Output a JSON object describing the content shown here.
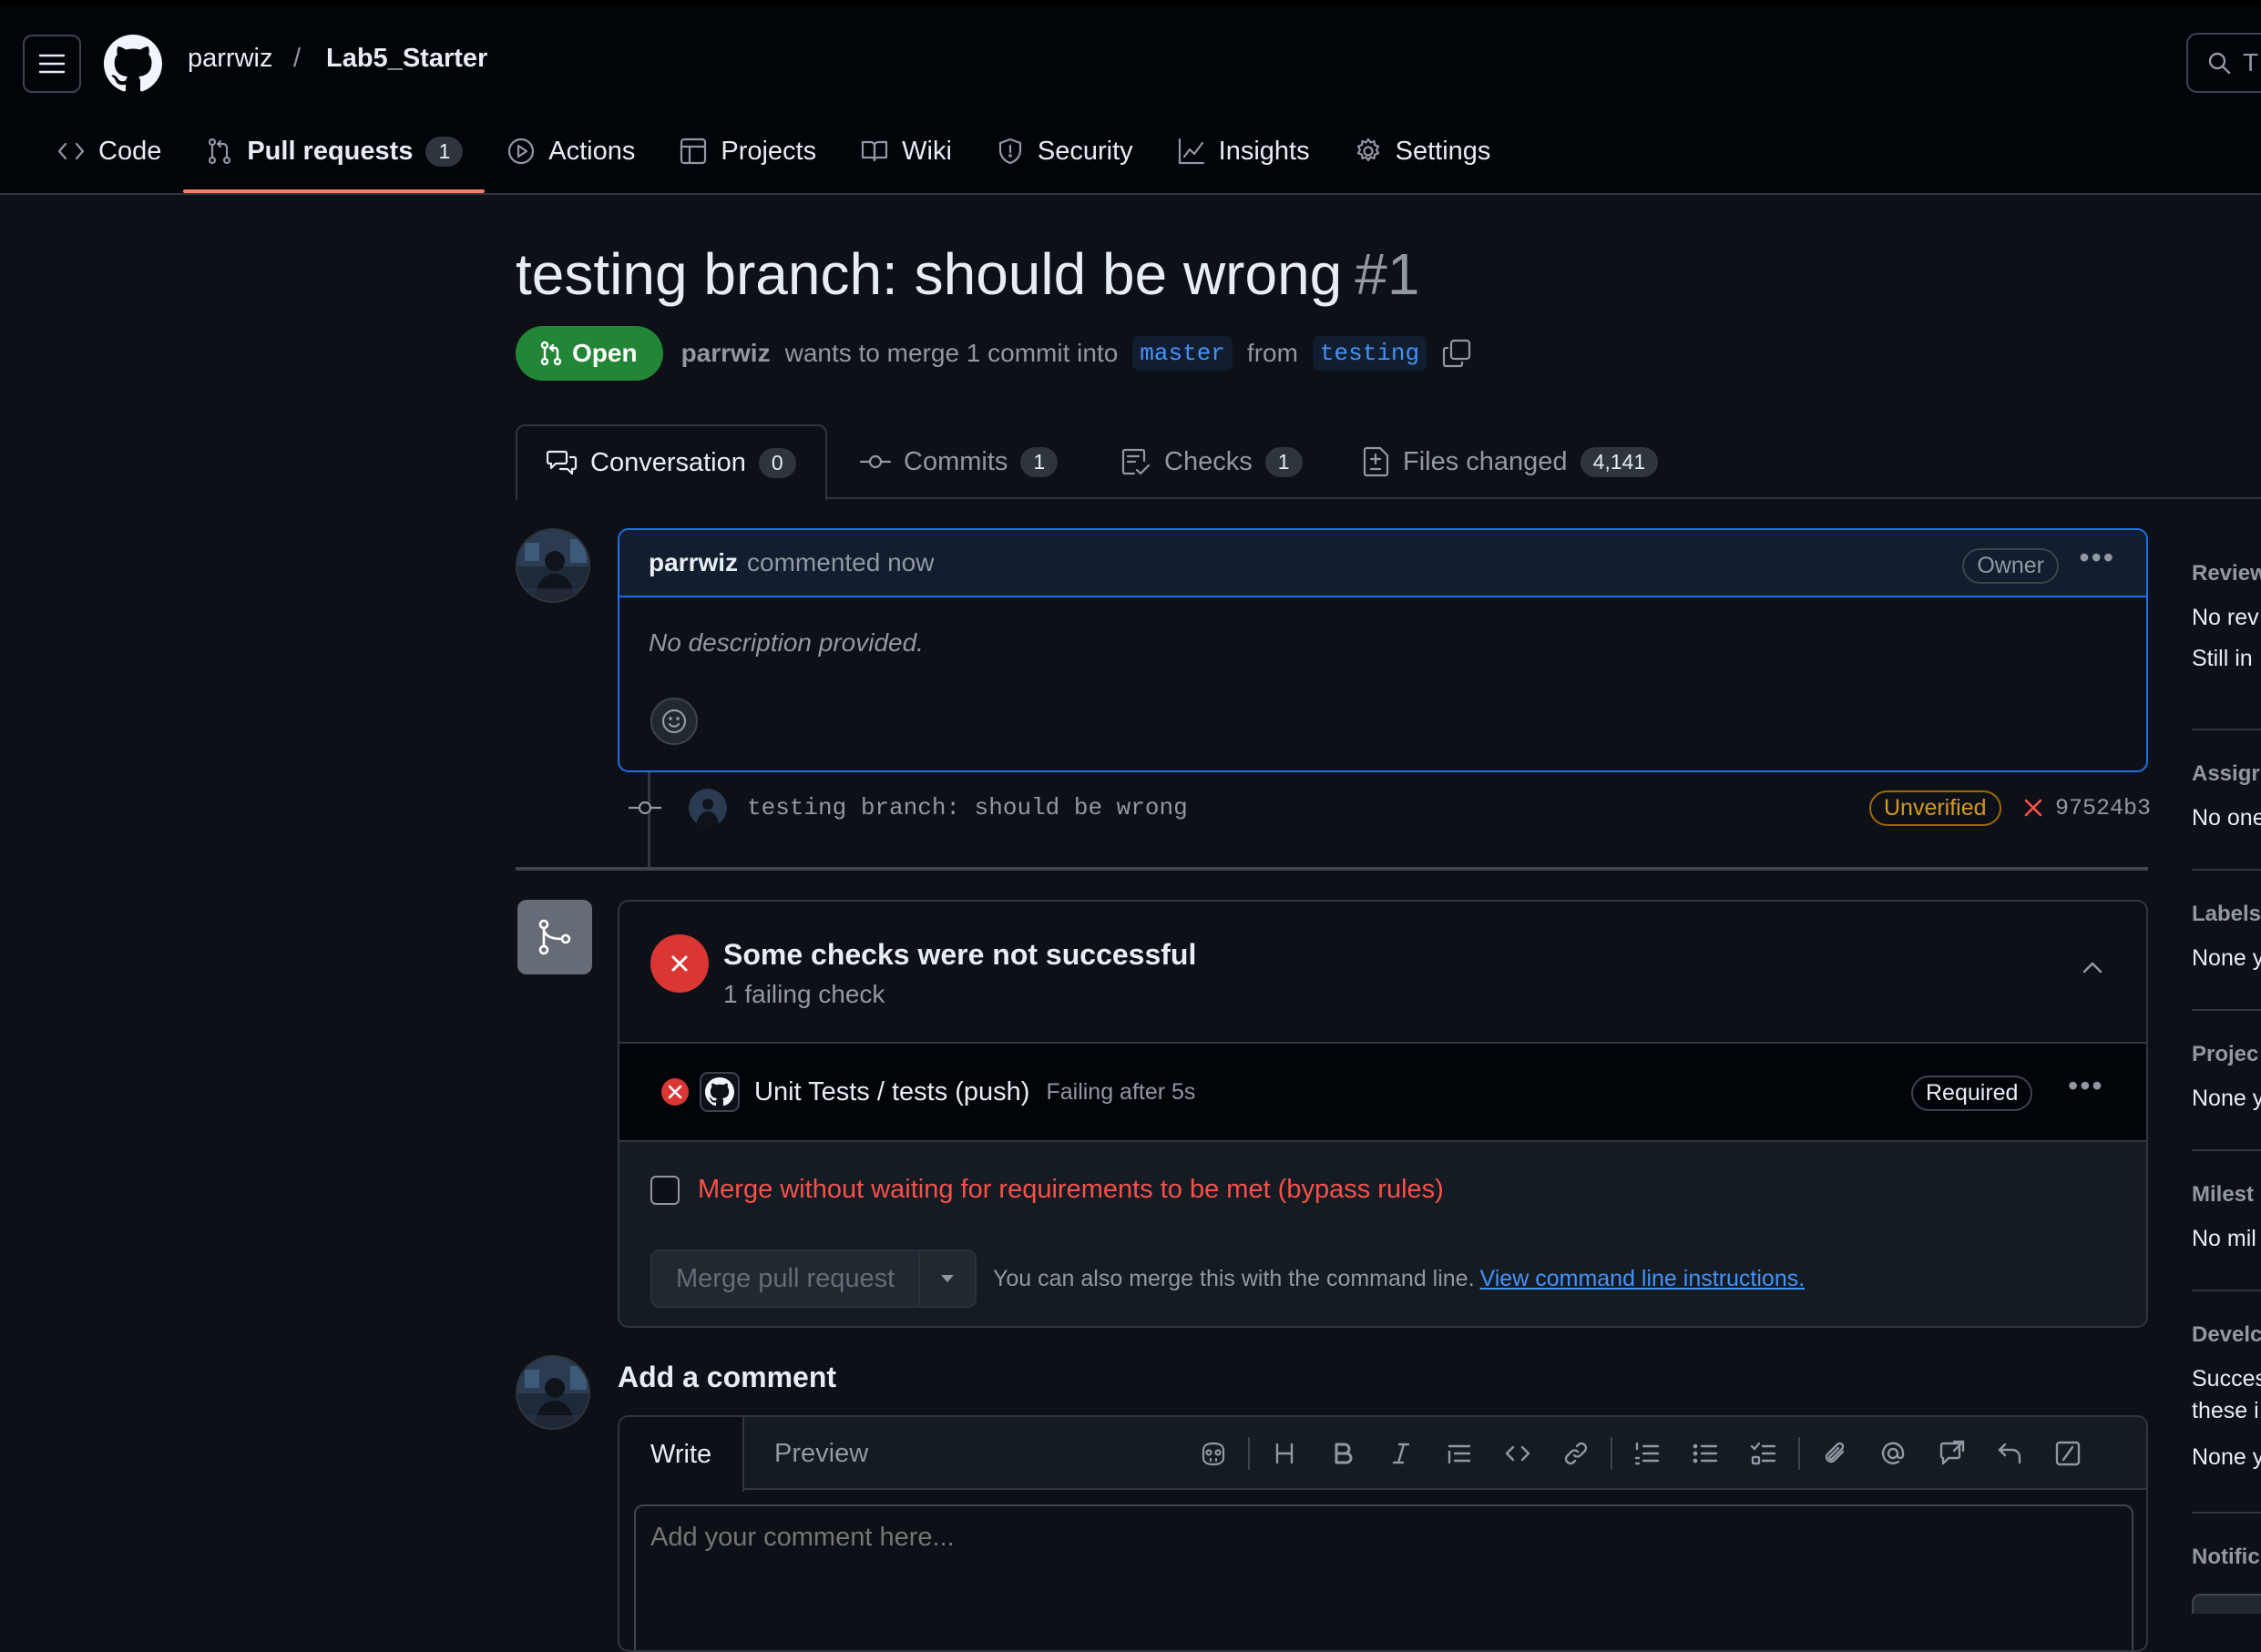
{
  "header": {
    "owner": "parrwiz",
    "separator": "/",
    "repo": "Lab5_Starter",
    "search_placeholder": "T"
  },
  "repo_nav": [
    {
      "label": "Code",
      "icon": "code-icon"
    },
    {
      "label": "Pull requests",
      "icon": "git-pull-request-icon",
      "count": "1",
      "active": true
    },
    {
      "label": "Actions",
      "icon": "play-icon"
    },
    {
      "label": "Projects",
      "icon": "table-icon"
    },
    {
      "label": "Wiki",
      "icon": "book-icon"
    },
    {
      "label": "Security",
      "icon": "shield-icon"
    },
    {
      "label": "Insights",
      "icon": "graph-icon"
    },
    {
      "label": "Settings",
      "icon": "gear-icon"
    }
  ],
  "pr": {
    "title": "testing branch: should be wrong",
    "number": "#1",
    "state": "Open",
    "author": "parrwiz",
    "merge_text": "wants to merge 1 commit into",
    "base_branch": "master",
    "from_text": "from",
    "head_branch": "testing"
  },
  "tabs": [
    {
      "label": "Conversation",
      "count": "0",
      "icon": "comment-discussion-icon"
    },
    {
      "label": "Commits",
      "count": "1",
      "icon": "git-commit-icon"
    },
    {
      "label": "Checks",
      "count": "1",
      "icon": "checklist-icon"
    },
    {
      "label": "Files changed",
      "count": "4,141",
      "icon": "file-diff-icon"
    }
  ],
  "comment": {
    "author": "parrwiz",
    "action": "commented now",
    "role_badge": "Owner",
    "body": "No description provided."
  },
  "commit": {
    "message": "testing branch: should be wrong",
    "badge": "Unverified",
    "sha": "97524b3"
  },
  "checks": {
    "title": "Some checks were not successful",
    "subtitle": "1 failing check",
    "items": [
      {
        "name": "Unit Tests / tests (push)",
        "duration": "Failing after 5s",
        "badge": "Required"
      }
    ]
  },
  "merge": {
    "bypass_label": "Merge without waiting for requirements to be met (bypass rules)",
    "button_label": "Merge pull request",
    "cli_text": "You can also merge this with the command line.",
    "cli_link": "View command line instructions."
  },
  "add_comment": {
    "title": "Add a comment",
    "write_tab": "Write",
    "preview_tab": "Preview",
    "placeholder": "Add your comment here...",
    "toolbar": [
      "copilot-icon",
      "heading-icon",
      "bold-icon",
      "italic-icon",
      "quote-icon",
      "code-icon",
      "link-icon",
      "ordered-list-icon",
      "unordered-list-icon",
      "task-list-icon",
      "attach-icon",
      "mention-icon",
      "reference-icon",
      "undo-icon",
      "slash-command-icon"
    ]
  },
  "sidebar": {
    "sections": [
      {
        "heading": "Review",
        "lines": [
          "No rev",
          "Still in"
        ]
      },
      {
        "heading": "Assigr",
        "lines": [
          "No one"
        ]
      },
      {
        "heading": "Labels",
        "lines": [
          "None y"
        ]
      },
      {
        "heading": "Projec",
        "lines": [
          "None y"
        ]
      },
      {
        "heading": "Milest",
        "lines": [
          "No mil"
        ]
      },
      {
        "heading": "Develc",
        "lines": [
          "Succes",
          "these i",
          "None y"
        ]
      },
      {
        "heading": "Notific",
        "lines": []
      }
    ]
  },
  "colors": {
    "accent_open": "#238636",
    "fail": "#da3633",
    "link": "#4493f8",
    "tab_underline": "#f78166"
  }
}
